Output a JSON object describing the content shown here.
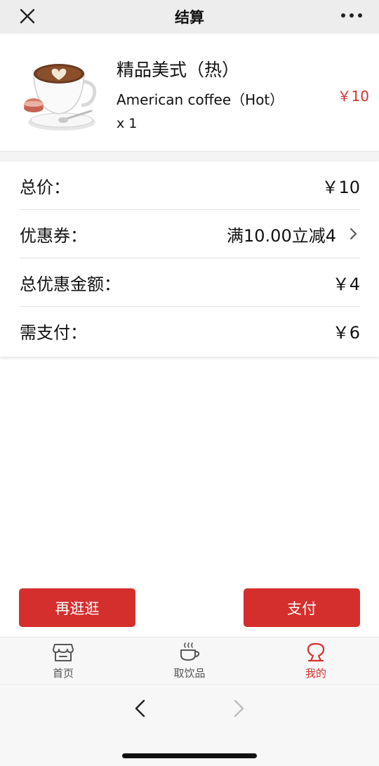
{
  "header": {
    "title": "结算",
    "close_icon": "close-icon",
    "more_icon": "more-icon"
  },
  "product": {
    "name_cn": "精品美式（热）",
    "name_en": "American coffee（Hot）",
    "quantity": "x 1",
    "price": "￥10",
    "image_icon": "coffee-cup-icon"
  },
  "summary": {
    "rows": [
      {
        "label": "总价：",
        "value": "￥10"
      },
      {
        "label": "优惠券：",
        "value": "满10.00立减4"
      },
      {
        "label": "总优惠金额：",
        "value": "￥4"
      },
      {
        "label": "需支付：",
        "value": "￥6"
      }
    ]
  },
  "buttons": {
    "browse_more": "再逛逛",
    "pay": "支付"
  },
  "tabs": [
    {
      "label": "首页",
      "icon": "store-icon",
      "active": false
    },
    {
      "label": "取饮品",
      "icon": "hot-cup-icon",
      "active": false
    },
    {
      "label": "我的",
      "icon": "profile-icon",
      "active": true
    }
  ],
  "colors": {
    "accent": "#d42f2d",
    "header_bg": "#ededed",
    "tabbar_bg": "#f7f7f7"
  }
}
